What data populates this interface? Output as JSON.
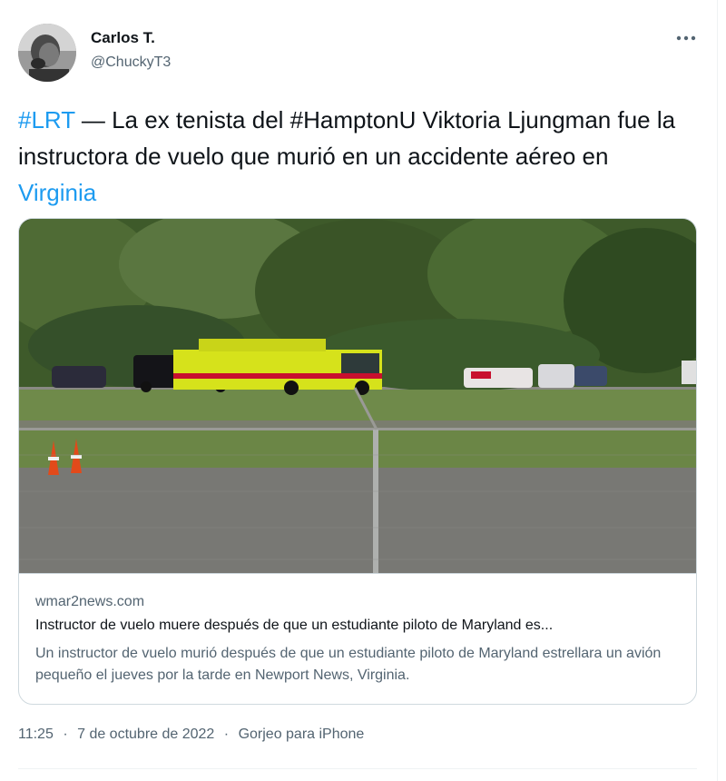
{
  "author": {
    "name": "Carlos T.",
    "handle": "@ChuckyT3",
    "avatar_icon": "person-photo-icon"
  },
  "more_icon": "more-horizontal-icon",
  "tweet": {
    "hashtag_lrt": "#LRT",
    "text_part1": " — La ex tenista del #HamptonU Viktoria Ljungman fue la instructora de vuelo que murió en un accidente aéreo en ",
    "link_virginia": "Virginia"
  },
  "card": {
    "image_icon": "airfield-photo",
    "domain": "wmar2news.com",
    "title": "Instructor de vuelo muere después de que un estudiante piloto de Maryland es...",
    "description": "Un instructor de vuelo murió después de que un estudiante piloto de Maryland estrellara un avión pequeño el jueves por la tarde en Newport News, Virginia."
  },
  "meta": {
    "time": "11:25",
    "date": "7 de octubre de 2022",
    "separator": "·",
    "source": "Gorjeo para iPhone"
  },
  "colors": {
    "link": "#1d9bf0",
    "secondary_text": "#536471",
    "border": "#cfd9de",
    "fire_truck": "#d6e21b"
  }
}
